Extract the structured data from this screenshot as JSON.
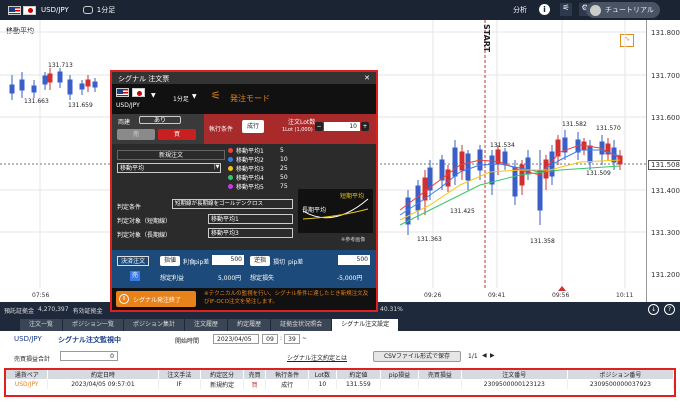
{
  "header": {
    "symbol": "USD/JPY",
    "timeframe": "1分足",
    "analysis": "分析",
    "tutorial": "チュートリアル"
  },
  "chart": {
    "indicator_label": "移動平均",
    "start_label": "START",
    "y_ticks": [
      "131.800",
      "131.700",
      "131.600",
      "131.508",
      "131.400",
      "131.300",
      "131.200"
    ],
    "x_ticks": [
      "07:56",
      "09:26",
      "09:41",
      "09:56",
      "10:11"
    ],
    "price_labels": [
      "131.713",
      "131.663",
      "131.659",
      "131.534",
      "131.582",
      "131.570",
      "131.509",
      "131.425",
      "131.363",
      "131.358"
    ],
    "current_price": "131.508"
  },
  "dialog": {
    "title": "シグナル 注文票",
    "symbol": "USD/JPY",
    "timeframe": "1分足",
    "mode": "発注モード",
    "hedge_label": "両建",
    "hedge_value": "あり",
    "sell_label": "売",
    "buy_label": "買",
    "exec_label": "執行条件",
    "exec_value": "成行",
    "lot_label": "注文Lot数",
    "lot_sub": "1Lot (1,000)",
    "lot_value": "10",
    "new_order": "新規注文",
    "indicator": "移動平均",
    "ma_list": [
      {
        "name": "移動平均1",
        "val": "5",
        "color": "#e8403a"
      },
      {
        "name": "移動平均2",
        "val": "10",
        "color": "#3a7be8"
      },
      {
        "name": "移動平均3",
        "val": "25",
        "color": "#f5c518"
      },
      {
        "name": "移動平均4",
        "val": "50",
        "color": "#3ac46a"
      },
      {
        "name": "移動平均5",
        "val": "75",
        "color": "#c83ae8"
      }
    ],
    "cond_label": "判定条件",
    "cond_value": "短期線が長期線をゴールデンクロス",
    "short_label": "判定対象（短期線）",
    "short_value": "移動平均1",
    "long_label": "判定対象（長期線）",
    "long_value": "移動平均3",
    "img_short": "短期平均",
    "img_long": "長期平均",
    "img_note": "※参考画像",
    "settle_label": "決済注文",
    "settle_flag": "売",
    "tp_label": "指値",
    "tp_sub": "利食",
    "tp_unit": "pip差",
    "tp_value": "500",
    "tp_amount_label": "想定利益",
    "tp_amount": "5,000円",
    "sl_label": "逆指",
    "sl_sub": "損切",
    "sl_unit": "pip差",
    "sl_value": "500",
    "sl_amount_label": "想定損失",
    "sl_amount": "-5,000円",
    "stop_btn": "シグナル発注終了",
    "notice": "※テクニカルの監視を行い、シグナル条件に達したとき新規注文及びIF-OCO注文を発注します。"
  },
  "status": {
    "margin_label": "預託証拠金",
    "margin_value": "4,270,397",
    "valid_label": "有効証拠金",
    "pct": "40.31%"
  },
  "tabs": [
    "注文一覧",
    "ポジション一覧",
    "ポジション集計",
    "注文履歴",
    "約定履歴",
    "証拠金状況照会",
    "シグナル注文設定"
  ],
  "panel": {
    "pair": "USD/JPY",
    "monitoring": "シグナル注文監視中",
    "start_label": "開始時間",
    "date": "2023/04/05",
    "hour": "09",
    "minute": "39",
    "pl_label": "売買損益合計",
    "pl_value": "0",
    "help": "シグナル注文約定とは",
    "csv": "CSVファイル形式で保存",
    "page": "1/1"
  },
  "table": {
    "headers": [
      "通貨ペア",
      "約定日時",
      "注文手法",
      "約定区分",
      "売買",
      "執行条件",
      "Lot数",
      "約定値",
      "pip損益",
      "売買損益",
      "注文番号",
      "ポジション番号"
    ],
    "rows": [
      [
        "USD/JPY",
        "2023/04/05 09:57:01",
        "IF",
        "新規約定",
        "買",
        "成行",
        "10",
        "131.559",
        "",
        "",
        "2309500000123123",
        "2309500000037923"
      ]
    ]
  }
}
